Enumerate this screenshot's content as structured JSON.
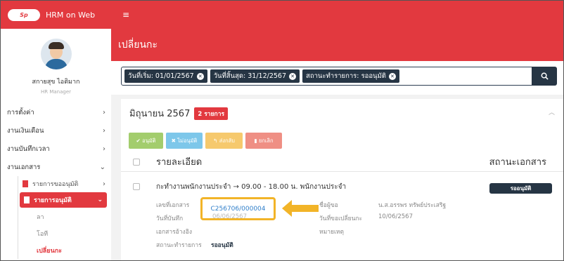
{
  "app": {
    "logo_text": "Sp",
    "name": "HRM on Web"
  },
  "profile": {
    "name": "สกายสุข ไอติมาก",
    "role": "HR Manager"
  },
  "menu": {
    "settings": "การตั้งค่า",
    "payroll": "งานเงินเดือน",
    "time": "งานบันทึกเวลา",
    "documents": "งานเอกสาร",
    "request_list": "รายการขออนุมัติ",
    "approve_list": "รายการอนุมัติ",
    "leave": "ลา",
    "ot": "โอที",
    "shift": "เปลี่ยนกะ"
  },
  "page": {
    "title": "เปลี่ยนกะ"
  },
  "filters": [
    {
      "label": "วันที่เริ่ม: 01/01/2567"
    },
    {
      "label": "วันที่สิ้นสุด: 31/12/2567"
    },
    {
      "label": "สถานะทำรายการ: รออนุมัติ"
    }
  ],
  "group": {
    "month": "มิถุนายน 2567",
    "count": "2 รายการ"
  },
  "actions": {
    "approve": "อนุมัติ",
    "reject": "ไม่อนุมัติ",
    "return": "ส่งกลับ",
    "cancel": "ยกเลิก"
  },
  "table": {
    "col_detail": "รายละเอียด",
    "col_status": "สถานะเอกสาร"
  },
  "record": {
    "title": "กะทำงานพนักงานประจำ → 09.00 - 18.00 น. พนักงานประจำ",
    "status": "รออนุมัติ",
    "doc_no_label": "เลขที่เอกสาร",
    "doc_no": "C256706/000004",
    "record_date_label": "วันที่บันทึก",
    "record_date": "06/06/2567",
    "ref_doc_label": "เอกสารอ้างอิง",
    "status_label": "สถานะทำรายการ",
    "status_value": "รออนุมัติ",
    "requester_label": "ชื่อผู้ขอ",
    "requester": "น.ส.อรรพร ทรัพย์ประเสริฐ",
    "change_date_label": "วันที่ขอเปลี่ยนกะ",
    "change_date": "10/06/2567",
    "note_label": "หมายเหตุ"
  },
  "colors": {
    "brand_red": "#e2393f",
    "navy": "#263544",
    "highlight": "#f2b428",
    "link": "#2f7ec9"
  }
}
